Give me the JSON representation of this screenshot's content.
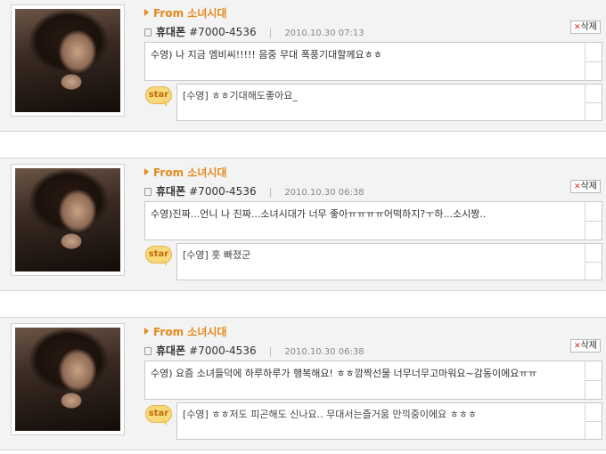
{
  "posts": [
    {
      "from": "From 소녀시대",
      "source": "휴대폰",
      "number": "#7000-4536",
      "separator": "|",
      "date": "2010.10.30 07:13",
      "delete_label": "삭제",
      "message": "수영) 나 지금 엠비씨!!!!! 음중 무대 폭풍기대할께요ㅎㅎ",
      "star_label": "star",
      "reply": "[수영] ㅎㅎ기대해도좋아요_"
    },
    {
      "from": "From 소녀시대",
      "source": "휴대폰",
      "number": "#7000-4536",
      "separator": "|",
      "date": "2010.10.30 06:38",
      "delete_label": "삭제",
      "message": "수영)진짜...언니 나 진짜...소녀시대가 너무 좋아ㅠㅠㅠㅠ어떡하지?ㅜ하...소시짱..",
      "star_label": "star",
      "reply": "[수영] 홋 빠졌군"
    },
    {
      "from": "From 소녀시대",
      "source": "휴대폰",
      "number": "#7000-4536",
      "separator": "|",
      "date": "2010.10.30 06:38",
      "delete_label": "삭제",
      "message": "수영) 요즘 소녀들덕에 하루하루가 행복해요! ㅎㅎ깜짝선물 너무너무고마워요~감동이에요ㅠㅠ",
      "star_label": "star",
      "reply": "[수영] ㅎㅎ저도 피곤해도 신나요.. 무대서는즐거움 만끽중이에요 ㅎㅎㅎ"
    }
  ]
}
